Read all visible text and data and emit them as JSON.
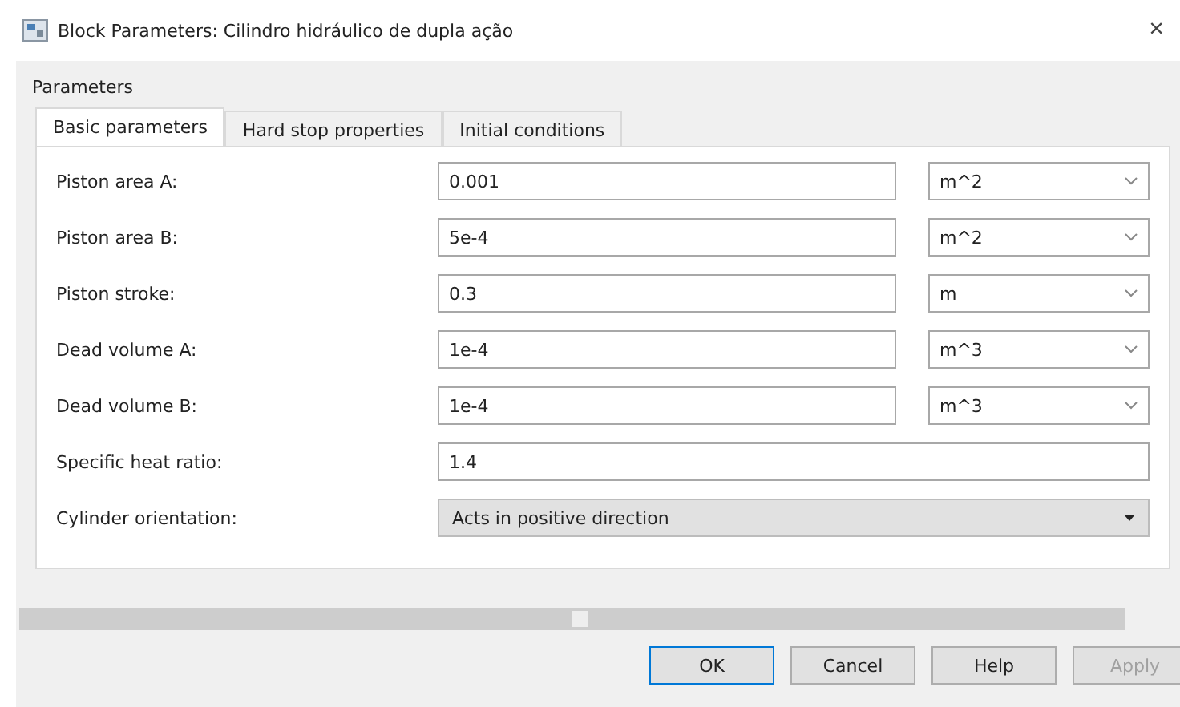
{
  "window": {
    "title": "Block Parameters: Cilindro hidráulico de dupla ação",
    "close": "×"
  },
  "group_title": "Parameters",
  "tabs": [
    {
      "label": "Basic parameters",
      "selected": true
    },
    {
      "label": "Hard stop properties",
      "selected": false
    },
    {
      "label": "Initial conditions",
      "selected": false
    }
  ],
  "rows": [
    {
      "kind": "unit",
      "label": "Piston area A:",
      "value": "0.001",
      "unit": "m^2"
    },
    {
      "kind": "unit",
      "label": "Piston area B:",
      "value": "5e-4",
      "unit": "m^2"
    },
    {
      "kind": "unit",
      "label": "Piston stroke:",
      "value": "0.3",
      "unit": "m"
    },
    {
      "kind": "unit",
      "label": "Dead volume A:",
      "value": "1e-4",
      "unit": "m^3"
    },
    {
      "kind": "unit",
      "label": "Dead volume B:",
      "value": "1e-4",
      "unit": "m^3"
    },
    {
      "kind": "plain",
      "label": "Specific heat ratio:",
      "value": "1.4"
    },
    {
      "kind": "select",
      "label": "Cylinder orientation:",
      "value": "Acts in positive direction"
    }
  ],
  "buttons": [
    {
      "label": "OK",
      "default": true,
      "disabled": false
    },
    {
      "label": "Cancel",
      "default": false,
      "disabled": false
    },
    {
      "label": "Help",
      "default": false,
      "disabled": false
    },
    {
      "label": "Apply",
      "default": false,
      "disabled": true
    }
  ]
}
